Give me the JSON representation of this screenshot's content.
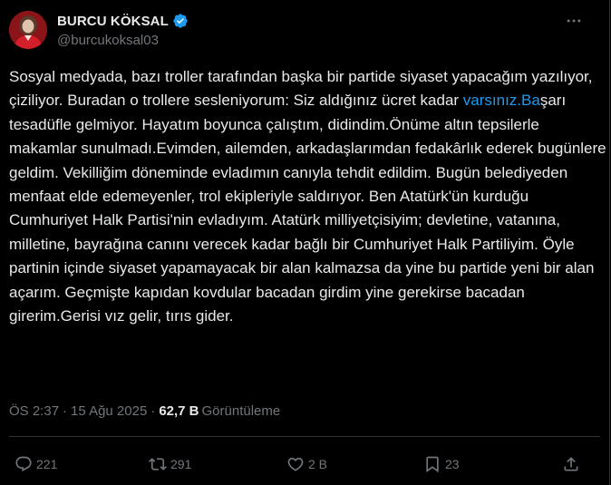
{
  "author": {
    "display_name": "BURCU KÖKSAL",
    "handle": "@burcukoksal03",
    "verified": true
  },
  "tweet": {
    "text_before_link": "Sosyal medyada, bazı troller tarafından başka bir partide siyaset yapacağım yazılıyor, çiziliyor. Buradan o trollere sesleniyorum: Siz aldığınız ücret kadar ",
    "link_text": "varsınız.Ba",
    "text_after_link": "şarı tesadüfle gelmiyor. Hayatım boyunca çalıştım, didindim.Önüme altın tepsilerle makamlar sunulmadı.Evimden, ailemden, arkadaşlarımdan fedakârlık ederek bugünlere geldim. Vekilliğim döneminde evladımın canıyla tehdit edildim. Bugün belediyeden menfaat elde edemeyenler, trol ekipleriyle saldırıyor. Ben Atatürk'ün kurduğu Cumhuriyet Halk Partisi'nin evladıyım. Atatürk milliyetçisiyim; devletine, vatanına, milletine, bayrağına canını verecek kadar bağlı bir Cumhuriyet Halk Partiliyim. Öyle partinin içinde siyaset yapamayacak bir alan kalmazsa da yine bu partide yeni bir alan açarım. Geçmişte kapıdan kovdular bacadan girdim yine gerekirse bacadan girerim.Gerisi vız gelir, tırıs gider."
  },
  "meta": {
    "time": "ÖS 2:37",
    "separator": "·",
    "date": "15 Ağu 2025",
    "views_count": "62,7 B",
    "views_label": "Görüntüleme"
  },
  "actions": {
    "replies": "221",
    "reposts": "291",
    "likes": "2 B",
    "bookmarks": "23"
  },
  "colors": {
    "background": "#000000",
    "text": "#e7e9ea",
    "secondary": "#71767b",
    "link": "#1d9bf0",
    "verified": "#1d9bf0",
    "divider": "#2f3336"
  },
  "icons": {
    "more": "more-horizontal-icon",
    "reply": "reply-icon",
    "repost": "repost-icon",
    "like": "heart-icon",
    "bookmark": "bookmark-icon",
    "share": "share-icon",
    "verified": "verified-badge-icon"
  }
}
